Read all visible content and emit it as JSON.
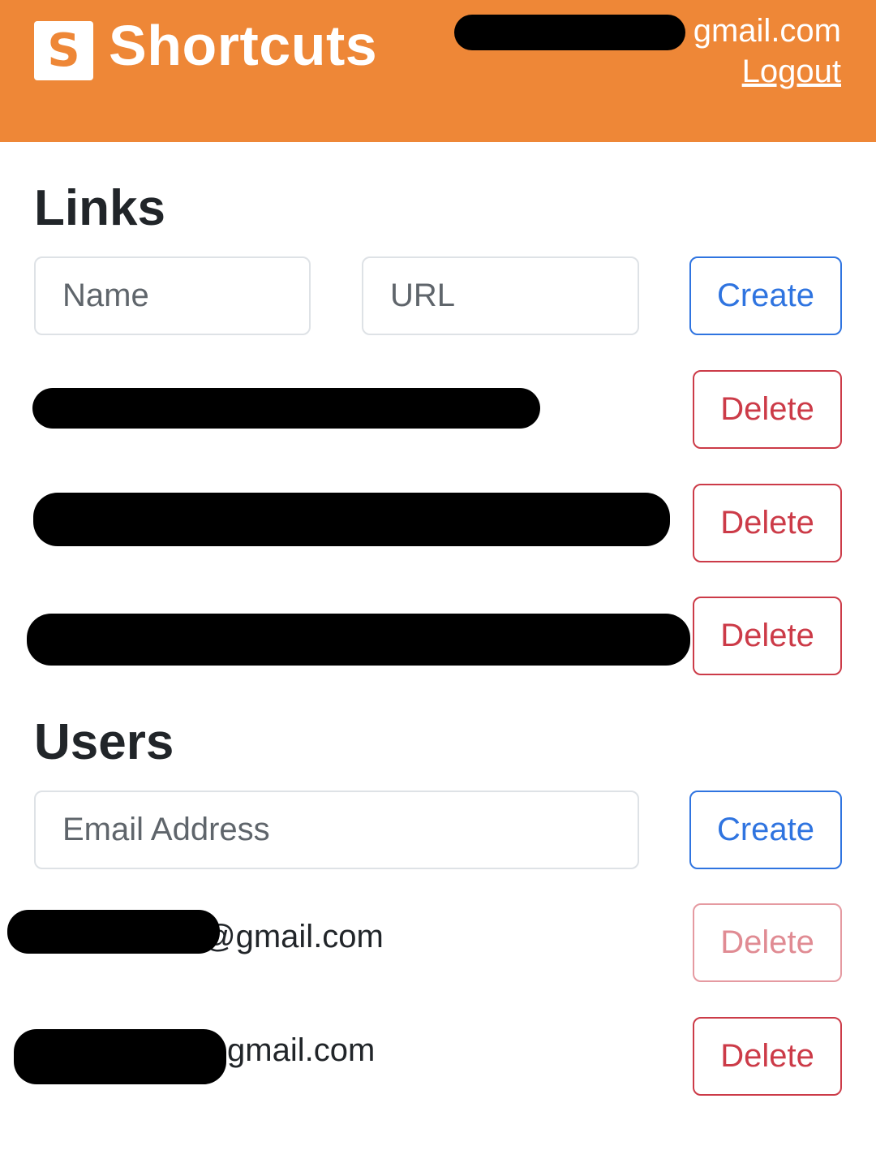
{
  "header": {
    "logo_letter": "S",
    "app_title": "Shortcuts",
    "user_email_visible": "gmail.com",
    "logout_label": "Logout"
  },
  "links": {
    "heading": "Links",
    "name_placeholder": "Name",
    "url_placeholder": "URL",
    "create_label": "Create",
    "items": [
      {
        "text": "",
        "delete_label": "Delete"
      },
      {
        "text": "",
        "delete_label": "Delete"
      },
      {
        "text": "",
        "delete_label": "Delete"
      }
    ]
  },
  "users": {
    "heading": "Users",
    "email_placeholder": "Email Address",
    "create_label": "Create",
    "items": [
      {
        "email_visible": "@gmail.com",
        "delete_label": "Delete",
        "disabled": true
      },
      {
        "email_visible": "gmail.com",
        "delete_label": "Delete",
        "disabled": false
      }
    ]
  },
  "colors": {
    "header_bg": "#ee8737",
    "primary": "#2f74e0",
    "danger": "#cc3b48"
  }
}
